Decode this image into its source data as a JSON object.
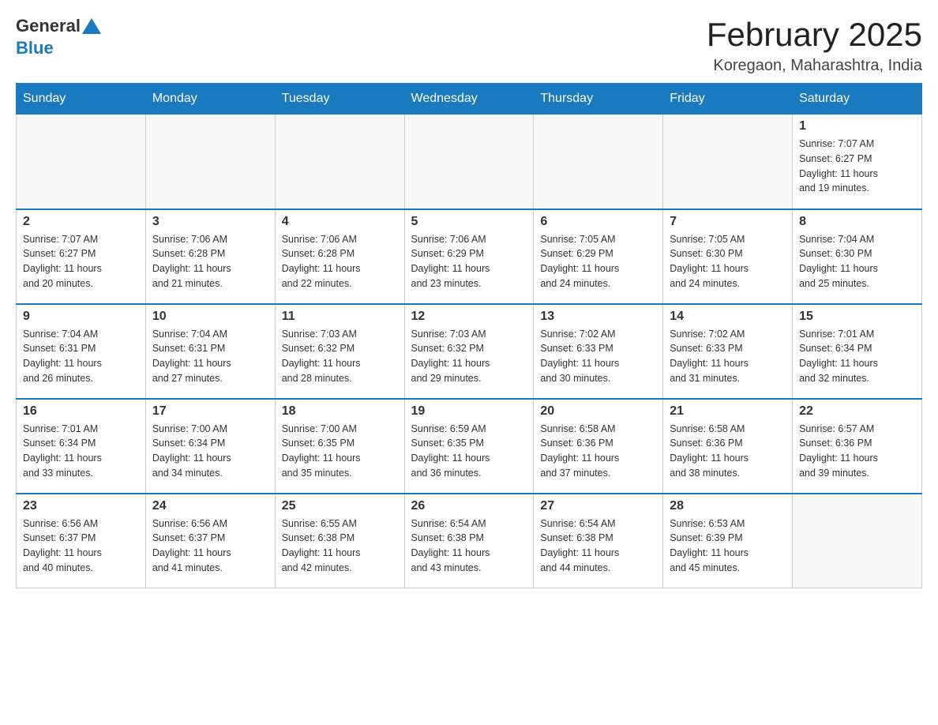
{
  "logo": {
    "general": "General",
    "blue": "Blue"
  },
  "title": "February 2025",
  "location": "Koregaon, Maharashtra, India",
  "days": [
    "Sunday",
    "Monday",
    "Tuesday",
    "Wednesday",
    "Thursday",
    "Friday",
    "Saturday"
  ],
  "weeks": [
    [
      {
        "num": "",
        "info": ""
      },
      {
        "num": "",
        "info": ""
      },
      {
        "num": "",
        "info": ""
      },
      {
        "num": "",
        "info": ""
      },
      {
        "num": "",
        "info": ""
      },
      {
        "num": "",
        "info": ""
      },
      {
        "num": "1",
        "info": "Sunrise: 7:07 AM\nSunset: 6:27 PM\nDaylight: 11 hours\nand 19 minutes."
      }
    ],
    [
      {
        "num": "2",
        "info": "Sunrise: 7:07 AM\nSunset: 6:27 PM\nDaylight: 11 hours\nand 20 minutes."
      },
      {
        "num": "3",
        "info": "Sunrise: 7:06 AM\nSunset: 6:28 PM\nDaylight: 11 hours\nand 21 minutes."
      },
      {
        "num": "4",
        "info": "Sunrise: 7:06 AM\nSunset: 6:28 PM\nDaylight: 11 hours\nand 22 minutes."
      },
      {
        "num": "5",
        "info": "Sunrise: 7:06 AM\nSunset: 6:29 PM\nDaylight: 11 hours\nand 23 minutes."
      },
      {
        "num": "6",
        "info": "Sunrise: 7:05 AM\nSunset: 6:29 PM\nDaylight: 11 hours\nand 24 minutes."
      },
      {
        "num": "7",
        "info": "Sunrise: 7:05 AM\nSunset: 6:30 PM\nDaylight: 11 hours\nand 24 minutes."
      },
      {
        "num": "8",
        "info": "Sunrise: 7:04 AM\nSunset: 6:30 PM\nDaylight: 11 hours\nand 25 minutes."
      }
    ],
    [
      {
        "num": "9",
        "info": "Sunrise: 7:04 AM\nSunset: 6:31 PM\nDaylight: 11 hours\nand 26 minutes."
      },
      {
        "num": "10",
        "info": "Sunrise: 7:04 AM\nSunset: 6:31 PM\nDaylight: 11 hours\nand 27 minutes."
      },
      {
        "num": "11",
        "info": "Sunrise: 7:03 AM\nSunset: 6:32 PM\nDaylight: 11 hours\nand 28 minutes."
      },
      {
        "num": "12",
        "info": "Sunrise: 7:03 AM\nSunset: 6:32 PM\nDaylight: 11 hours\nand 29 minutes."
      },
      {
        "num": "13",
        "info": "Sunrise: 7:02 AM\nSunset: 6:33 PM\nDaylight: 11 hours\nand 30 minutes."
      },
      {
        "num": "14",
        "info": "Sunrise: 7:02 AM\nSunset: 6:33 PM\nDaylight: 11 hours\nand 31 minutes."
      },
      {
        "num": "15",
        "info": "Sunrise: 7:01 AM\nSunset: 6:34 PM\nDaylight: 11 hours\nand 32 minutes."
      }
    ],
    [
      {
        "num": "16",
        "info": "Sunrise: 7:01 AM\nSunset: 6:34 PM\nDaylight: 11 hours\nand 33 minutes."
      },
      {
        "num": "17",
        "info": "Sunrise: 7:00 AM\nSunset: 6:34 PM\nDaylight: 11 hours\nand 34 minutes."
      },
      {
        "num": "18",
        "info": "Sunrise: 7:00 AM\nSunset: 6:35 PM\nDaylight: 11 hours\nand 35 minutes."
      },
      {
        "num": "19",
        "info": "Sunrise: 6:59 AM\nSunset: 6:35 PM\nDaylight: 11 hours\nand 36 minutes."
      },
      {
        "num": "20",
        "info": "Sunrise: 6:58 AM\nSunset: 6:36 PM\nDaylight: 11 hours\nand 37 minutes."
      },
      {
        "num": "21",
        "info": "Sunrise: 6:58 AM\nSunset: 6:36 PM\nDaylight: 11 hours\nand 38 minutes."
      },
      {
        "num": "22",
        "info": "Sunrise: 6:57 AM\nSunset: 6:36 PM\nDaylight: 11 hours\nand 39 minutes."
      }
    ],
    [
      {
        "num": "23",
        "info": "Sunrise: 6:56 AM\nSunset: 6:37 PM\nDaylight: 11 hours\nand 40 minutes."
      },
      {
        "num": "24",
        "info": "Sunrise: 6:56 AM\nSunset: 6:37 PM\nDaylight: 11 hours\nand 41 minutes."
      },
      {
        "num": "25",
        "info": "Sunrise: 6:55 AM\nSunset: 6:38 PM\nDaylight: 11 hours\nand 42 minutes."
      },
      {
        "num": "26",
        "info": "Sunrise: 6:54 AM\nSunset: 6:38 PM\nDaylight: 11 hours\nand 43 minutes."
      },
      {
        "num": "27",
        "info": "Sunrise: 6:54 AM\nSunset: 6:38 PM\nDaylight: 11 hours\nand 44 minutes."
      },
      {
        "num": "28",
        "info": "Sunrise: 6:53 AM\nSunset: 6:39 PM\nDaylight: 11 hours\nand 45 minutes."
      },
      {
        "num": "",
        "info": ""
      }
    ]
  ]
}
